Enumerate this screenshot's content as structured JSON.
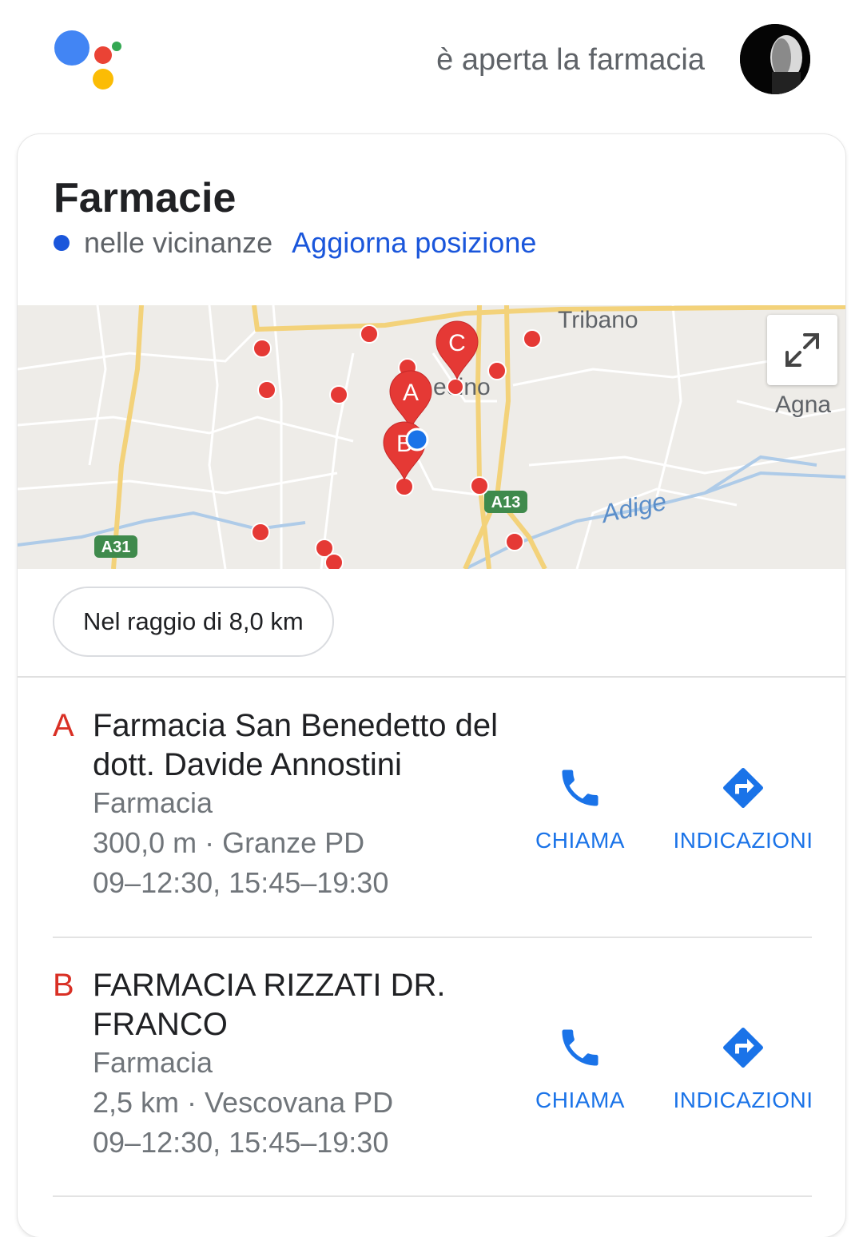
{
  "header": {
    "query": "è aperta la farmacia",
    "logo_icon": "google-assistant-icon",
    "logo_colors": [
      "#4285F4",
      "#EA4335",
      "#FBBC05",
      "#34A853"
    ]
  },
  "card": {
    "title": "Farmacie",
    "nearby": "nelle vicinanze",
    "update_location": "Aggiorna posizione",
    "map": {
      "labels": [
        "Tribano",
        "Agna",
        "Adige",
        "A13",
        "A31",
        "ecino"
      ],
      "markers": [
        "A",
        "B",
        "C"
      ]
    },
    "radius_chip": "Nel raggio di 8,0 km"
  },
  "results": [
    {
      "letter": "A",
      "name": "Farmacia San Benedetto del dott. Davide Annostini",
      "category": "Farmacia",
      "distance_place": "300,0 m · Granze PD",
      "hours": "09–12:30, 15:45–19:30",
      "call_label": "CHIAMA",
      "directions_label": "INDICAZIONI"
    },
    {
      "letter": "B",
      "name": "FARMACIA RIZZATI DR. FRANCO",
      "category": "Farmacia",
      "distance_place": "2,5 km · Vescovana PD",
      "hours": "09–12:30, 15:45–19:30",
      "call_label": "CHIAMA",
      "directions_label": "INDICAZIONI"
    }
  ],
  "colors": {
    "accent": "#1a73e8",
    "marker": "#e53935",
    "letter": "#d93025"
  }
}
